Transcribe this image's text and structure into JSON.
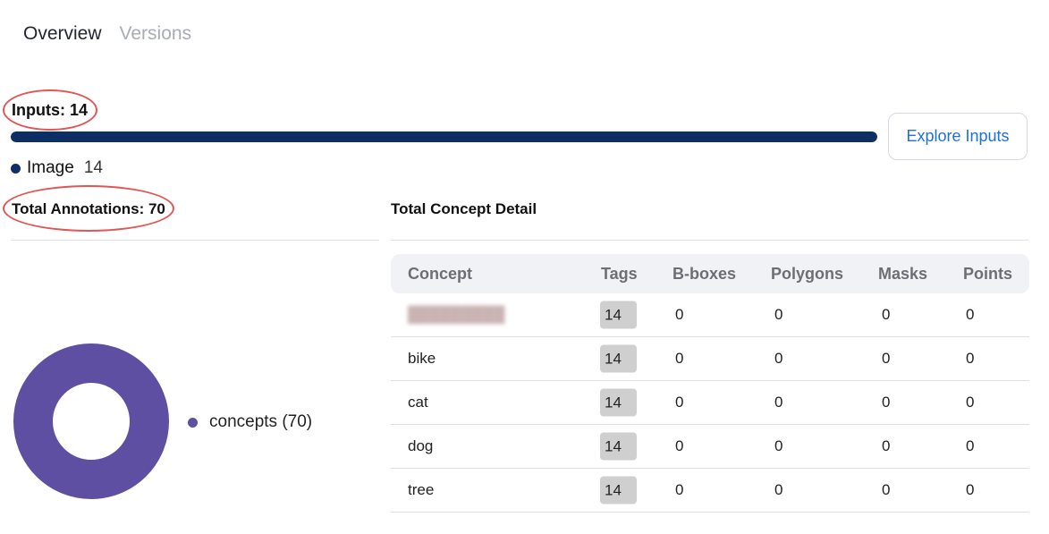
{
  "tabs": [
    {
      "label": "Overview",
      "active": true
    },
    {
      "label": "Versions",
      "active": false
    }
  ],
  "inputs": {
    "title": "Inputs: 14",
    "progress_fraction": 1.0,
    "legend": {
      "label": "Image",
      "count": "14"
    },
    "explore_label": "Explore Inputs"
  },
  "annotations": {
    "title": "Total Annotations: 70",
    "legend_label": "concepts (70)"
  },
  "concept_detail": {
    "title": "Total Concept Detail",
    "headers": [
      "Concept",
      "Tags",
      "B-boxes",
      "Polygons",
      "Masks",
      "Points"
    ],
    "rows": [
      {
        "concept": "",
        "tags": "14",
        "bboxes": "0",
        "polygons": "0",
        "masks": "0",
        "points": "0"
      },
      {
        "concept": "bike",
        "tags": "14",
        "bboxes": "0",
        "polygons": "0",
        "masks": "0",
        "points": "0"
      },
      {
        "concept": "cat",
        "tags": "14",
        "bboxes": "0",
        "polygons": "0",
        "masks": "0",
        "points": "0"
      },
      {
        "concept": "dog",
        "tags": "14",
        "bboxes": "0",
        "polygons": "0",
        "masks": "0",
        "points": "0"
      },
      {
        "concept": "tree",
        "tags": "14",
        "bboxes": "0",
        "polygons": "0",
        "masks": "0",
        "points": "0"
      }
    ]
  },
  "colors": {
    "image_series": "#0d2f66",
    "concepts_series": "#5e4fa2",
    "link": "#1f6fe0",
    "highlight": "#e25555"
  }
}
